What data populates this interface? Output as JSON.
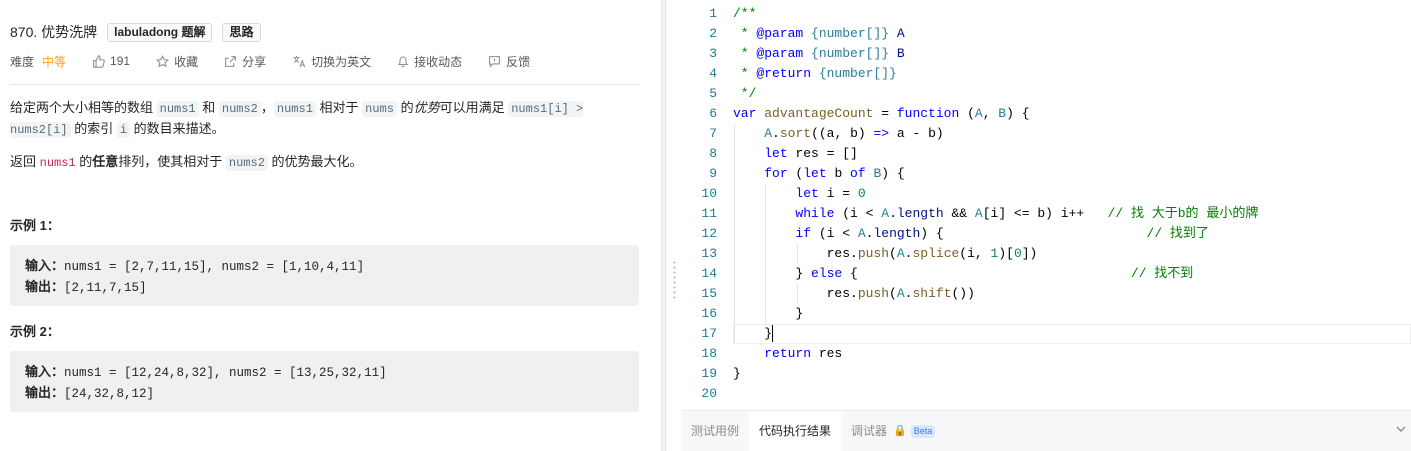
{
  "problem": {
    "title": "870. 优势洗牌",
    "tags": [
      "labuladong 题解",
      "思路"
    ],
    "meta": {
      "difficulty_label": "难度",
      "difficulty_value": "中等",
      "likes": "191",
      "favorite": "收藏",
      "share": "分享",
      "switch_lang": "切换为英文",
      "notifications": "接收动态",
      "feedback": "反馈"
    },
    "desc": {
      "p1": {
        "t1": "给定两个大小相等的数组 ",
        "c1": "nums1",
        "t2": " 和 ",
        "c2": "nums2",
        "t3": "，",
        "c3": "nums1",
        "t4": " 相对于 ",
        "c4": "nums",
        "t5": " 的",
        "em": "优势",
        "t6": "可以用满足 ",
        "c5": "nums1[i] > nums2[i]",
        "t7": " 的索引 ",
        "c6": "i",
        "t8": " 的数目来描述。"
      },
      "p2": {
        "t1": "返回 ",
        "c1": "nums1",
        "t2": " 的",
        "strong": "任意",
        "t3": "排列，使其相对于 ",
        "c2": "nums2",
        "t4": " 的优势最大化。"
      }
    },
    "examples": [
      {
        "title": "示例 1：",
        "input_label": "输入：",
        "input": "nums1 = [2,7,11,15], nums2 = [1,10,4,11]",
        "output_label": "输出：",
        "output": "[2,11,7,15]"
      },
      {
        "title": "示例 2：",
        "input_label": "输入：",
        "input": "nums1 = [12,24,8,32], nums2 = [13,25,32,11]",
        "output_label": "输出：",
        "output": "[24,32,8,12]"
      }
    ]
  },
  "editor": {
    "current_line": 17,
    "code_lines": [
      "/**",
      " * @param {number[]} A",
      " * @param {number[]} B",
      " * @return {number[]}",
      " */",
      "var advantageCount = function (A, B) {",
      "    A.sort((a, b) => a - b)",
      "    let res = []",
      "    for (let b of B) {",
      "        let i = 0",
      "        while (i < A.length && A[i] <= b) i++   // 找 大于b的 最小的牌",
      "        if (i < A.length) {                          // 找到了",
      "            res.push(A.splice(i, 1)[0])",
      "        } else {                                   // 找不到",
      "            res.push(A.shift())",
      "        }",
      "    }",
      "    return res",
      "}",
      ""
    ]
  },
  "bottom_tabs": {
    "tab1": "测试用例",
    "tab2": "代码执行结果",
    "tab3": "调试器",
    "beta": "Beta"
  }
}
